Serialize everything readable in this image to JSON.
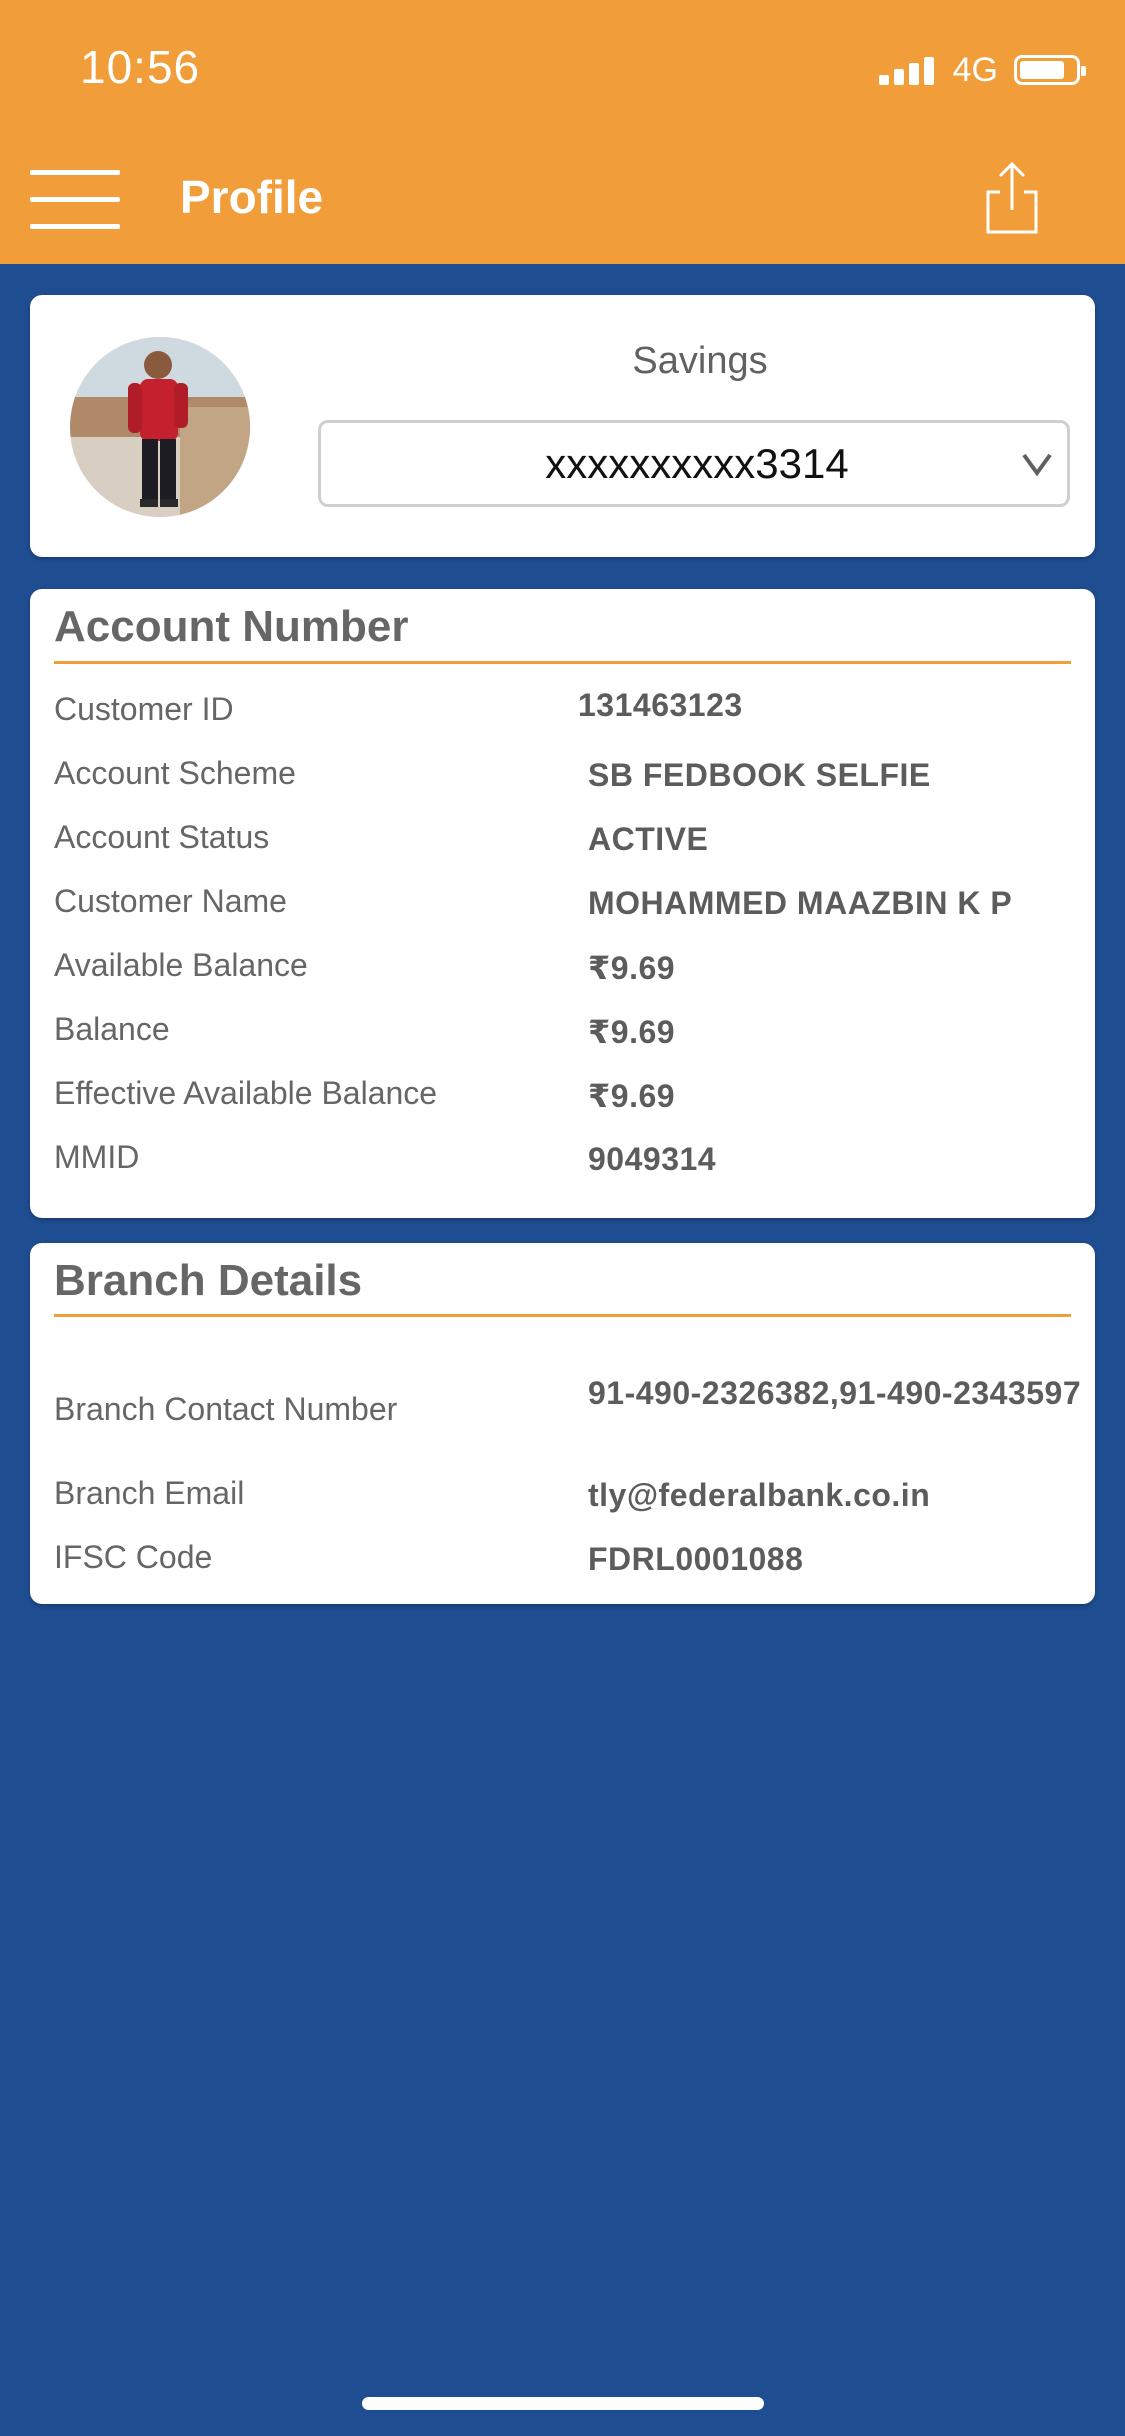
{
  "status_bar": {
    "time": "10:56",
    "network": "4G"
  },
  "header": {
    "title": "Profile",
    "menu_icon": "hamburger-menu-icon",
    "share_icon": "share-icon"
  },
  "account_selector": {
    "account_type": "Savings",
    "account_number": "xxxxxxxxxx3314"
  },
  "account_details": {
    "title": "Account Number",
    "rows": [
      {
        "label": "Customer ID",
        "value": "131463123"
      },
      {
        "label": "Account Scheme",
        "value": "SB FEDBOOK SELFIE"
      },
      {
        "label": "Account Status",
        "value": "ACTIVE"
      },
      {
        "label": "Customer Name",
        "value": "MOHAMMED MAAZBIN K P"
      },
      {
        "label": "Available Balance",
        "value": "₹9.69"
      },
      {
        "label": "Balance",
        "value": "₹9.69"
      },
      {
        "label": "Effective Available Balance",
        "value": "₹9.69"
      },
      {
        "label": "MMID",
        "value": "9049314"
      }
    ]
  },
  "branch_details": {
    "title": "Branch Details",
    "rows": [
      {
        "label": "Branch Contact Number",
        "value": "91-490-2326382,91-490-2343597"
      },
      {
        "label": "Branch Email",
        "value": "tly@federalbank.co.in"
      },
      {
        "label": "IFSC Code",
        "value": "FDRL0001088"
      }
    ]
  },
  "colors": {
    "header_orange": "#f09d3a",
    "background_blue": "#1f4d91",
    "card_white": "#ffffff",
    "text_gray": "#666666"
  }
}
